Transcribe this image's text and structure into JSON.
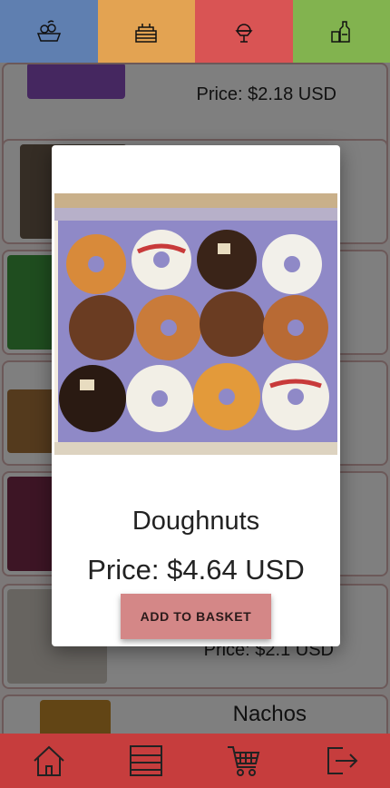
{
  "colors": {
    "cat_blue": "#5f7fb0",
    "cat_orange": "#e3a352",
    "cat_red": "#d95454",
    "cat_green": "#82b34f",
    "nav_red": "#c63d3d",
    "button": "#d48787"
  },
  "categories": [
    {
      "icon": "fruit-basket-icon"
    },
    {
      "icon": "cake-icon"
    },
    {
      "icon": "ice-cream-icon"
    },
    {
      "icon": "drinks-icon"
    }
  ],
  "products": [
    {
      "price": "Price: $2.18 USD"
    },
    {},
    {},
    {},
    {},
    {
      "price": "Price: $2.1 USD"
    },
    {
      "name": "Nachos"
    }
  ],
  "modal": {
    "title": "Doughnuts",
    "price": "Price: $4.64 USD",
    "add_label": "ADD TO BASKET"
  },
  "nav": [
    {
      "icon": "home-icon"
    },
    {
      "icon": "menu-list-icon"
    },
    {
      "icon": "cart-icon"
    },
    {
      "icon": "logout-icon"
    }
  ]
}
